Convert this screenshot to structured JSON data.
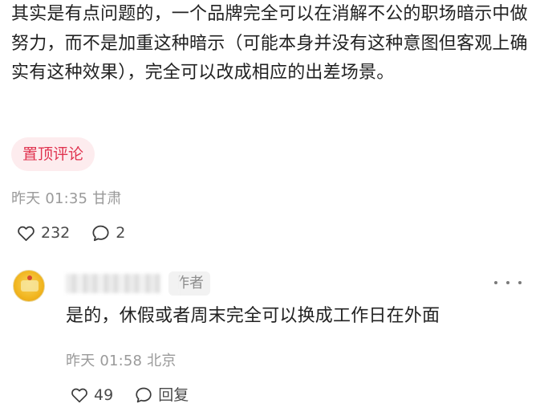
{
  "main_comment": {
    "text": "其实是有点问题的，一个品牌完全可以在消解不公的职场暗示中做努力，而不是加重这种暗示（可能本身并没有这种意图但客观上确实有这种效果），完全可以改成相应的出差场景。",
    "badge": "置顶评论",
    "meta": "昨天 01:35 甘肃",
    "like_count": "232",
    "reply_count": "2"
  },
  "reply": {
    "author_tag": "作者",
    "text": "是的，休假或者周末完全可以换成工作日在外面",
    "meta": "昨天 01:58 北京",
    "like_count": "49",
    "reply_label": "回复"
  },
  "icons": {
    "like": "heart-outline-icon",
    "comment": "speech-bubble-icon",
    "more": "more-dots-icon"
  },
  "colors": {
    "badge_text": "#e0334f",
    "badge_bg": "#fdecee",
    "meta_text": "#9a9a9a",
    "body_text": "#222222"
  }
}
